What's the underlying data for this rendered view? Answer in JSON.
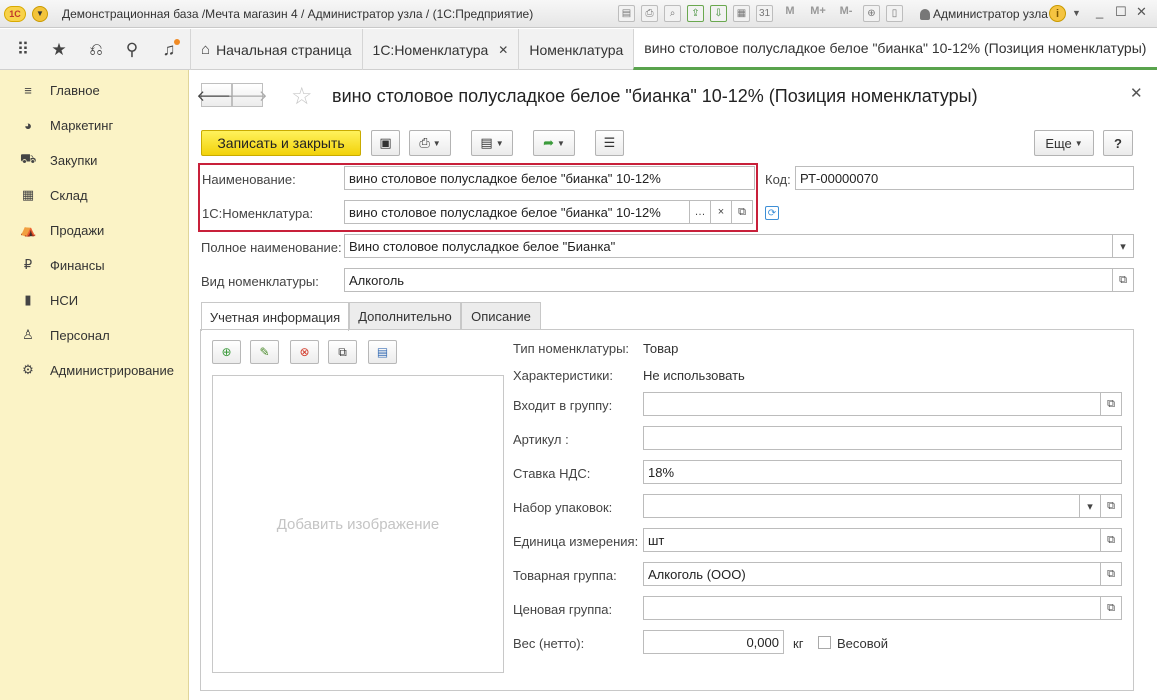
{
  "titlebar": {
    "logo": "1С",
    "title": "Демонстрационная база /Мечта магазин 4 / Администратор узла  /  (1С:Предприятие)",
    "tools": [
      "M",
      "M+",
      "M-"
    ],
    "user": "Администратор узла"
  },
  "tabs": [
    {
      "label": "Начальная страница"
    },
    {
      "label": "1С:Номенклатура"
    },
    {
      "label": "Номенклатура"
    },
    {
      "label": "вино столовое полусладкое белое \"бианка\" 10-12% (Позиция номенклатуры)"
    }
  ],
  "sidebar": {
    "items": [
      {
        "label": "Главное",
        "icon": "menu-icon"
      },
      {
        "label": "Маркетинг",
        "icon": "pie-chart-icon"
      },
      {
        "label": "Закупки",
        "icon": "truck-icon"
      },
      {
        "label": "Склад",
        "icon": "warehouse-icon"
      },
      {
        "label": "Продажи",
        "icon": "basket-icon"
      },
      {
        "label": "Финансы",
        "icon": "ruble-icon"
      },
      {
        "label": "НСИ",
        "icon": "book-icon"
      },
      {
        "label": "Персонал",
        "icon": "person-icon"
      },
      {
        "label": "Администрирование",
        "icon": "gear-icon"
      }
    ]
  },
  "form": {
    "title": "вино столовое полусладкое белое \"бианка\" 10-12% (Позиция номенклатуры)",
    "save_close": "Записать и закрыть",
    "more": "Еще",
    "help": "?",
    "name_label": "Наименование:",
    "name_value": "вино столовое полусладкое белое \"бианка\" 10-12%",
    "code_label": "Код:",
    "code_value": "РТ-00000070",
    "nom1c_label": "1С:Номенклатура:",
    "nom1c_value": "вино столовое полусладкое белое \"бианка\" 10-12%",
    "fullname_label": "Полное наименование:",
    "fullname_value": "Вино столовое полусладкое белое \"Бианка\"",
    "kind_label": "Вид номенклатуры:",
    "kind_value": "Алкоголь",
    "inner_tabs": [
      "Учетная информация",
      "Дополнительно",
      "Описание"
    ],
    "add_image": "Добавить изображение",
    "type_label": "Тип номенклатуры:",
    "type_value": "Товар",
    "chars_label": "Характеристики:",
    "chars_value": "Не использовать",
    "group_label": "Входит в группу:",
    "group_value": "",
    "article_label": "Артикул :",
    "article_value": "",
    "vat_label": "Ставка НДС:",
    "vat_value": "18%",
    "pack_label": "Набор упаковок:",
    "pack_value": "",
    "unit_label": "Единица измерения:",
    "unit_value": "шт",
    "goods_group_label": "Товарная группа:",
    "goods_group_value": "Алкоголь (ООО)",
    "price_group_label": "Ценовая группа:",
    "price_group_value": "",
    "weight_label": "Вес (нетто):",
    "weight_value": "0,000",
    "weight_unit": "кг",
    "weighable_label": "Весовой"
  },
  "colors": {
    "primary_button": "#f2d20a",
    "sidebar_bg": "#fbf3c6",
    "highlight_frame": "#c8203a",
    "active_tab_underline": "#59a34d"
  }
}
